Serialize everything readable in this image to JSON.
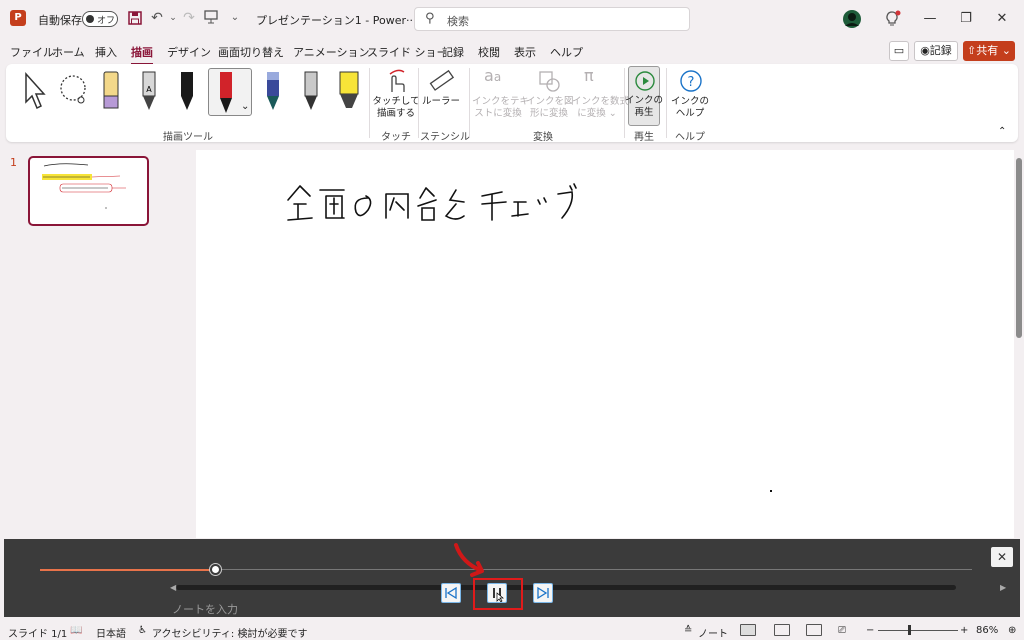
{
  "titlebar": {
    "app_icon": "P",
    "autosave_label": "自動保存",
    "autosave_state": "オフ",
    "doc_title": "プレゼンテーション1 - Power···",
    "search_placeholder": "検索"
  },
  "tabs": [
    {
      "label": "ファイル"
    },
    {
      "label": "ホーム"
    },
    {
      "label": "挿入"
    },
    {
      "label": "描画"
    },
    {
      "label": "デザイン"
    },
    {
      "label": "画面切り替え"
    },
    {
      "label": "アニメーション"
    },
    {
      "label": "スライド ショー"
    },
    {
      "label": "記録"
    },
    {
      "label": "校閲"
    },
    {
      "label": "表示"
    },
    {
      "label": "ヘルプ"
    }
  ],
  "header_buttons": {
    "record_label": "記録",
    "share_label": "共有"
  },
  "ribbon": {
    "groups": {
      "draw_tools": "描画ツール",
      "touch": "タッチ",
      "stencil": "ステンシル",
      "convert": "変換",
      "replay": "再生",
      "help": "ヘルプ"
    },
    "buttons": {
      "touch_draw": [
        "タッチして",
        "描画する"
      ],
      "ruler": [
        "ルーラー"
      ],
      "ink_to_text": [
        "インクをテキ",
        "ストに変換"
      ],
      "ink_to_shape": [
        "インクを図",
        "形に変換"
      ],
      "ink_to_math": [
        "インクを数式",
        "に変換 ⌄"
      ],
      "ink_replay": [
        "インクの",
        "再生"
      ],
      "ink_help": [
        "インクの",
        "ヘルプ"
      ]
    }
  },
  "slide_pane": {
    "slide_number": "1"
  },
  "slide": {
    "handwriting_text": "企画の内容をチェック"
  },
  "replay_bar": {
    "note_placeholder": "ノートを入力",
    "progress": 0.25
  },
  "status": {
    "slide_info": "スライド 1/1",
    "language": "日本語",
    "accessibility": "アクセシビリティ: 検討が必要です",
    "notes_label": "ノート",
    "zoom": "86%"
  },
  "colors": {
    "accent": "#8a1538",
    "brand": "#c43e1c",
    "replay_bg": "#3b3b3b",
    "progress": "#e8734a",
    "highlight": "#e01b1b"
  }
}
